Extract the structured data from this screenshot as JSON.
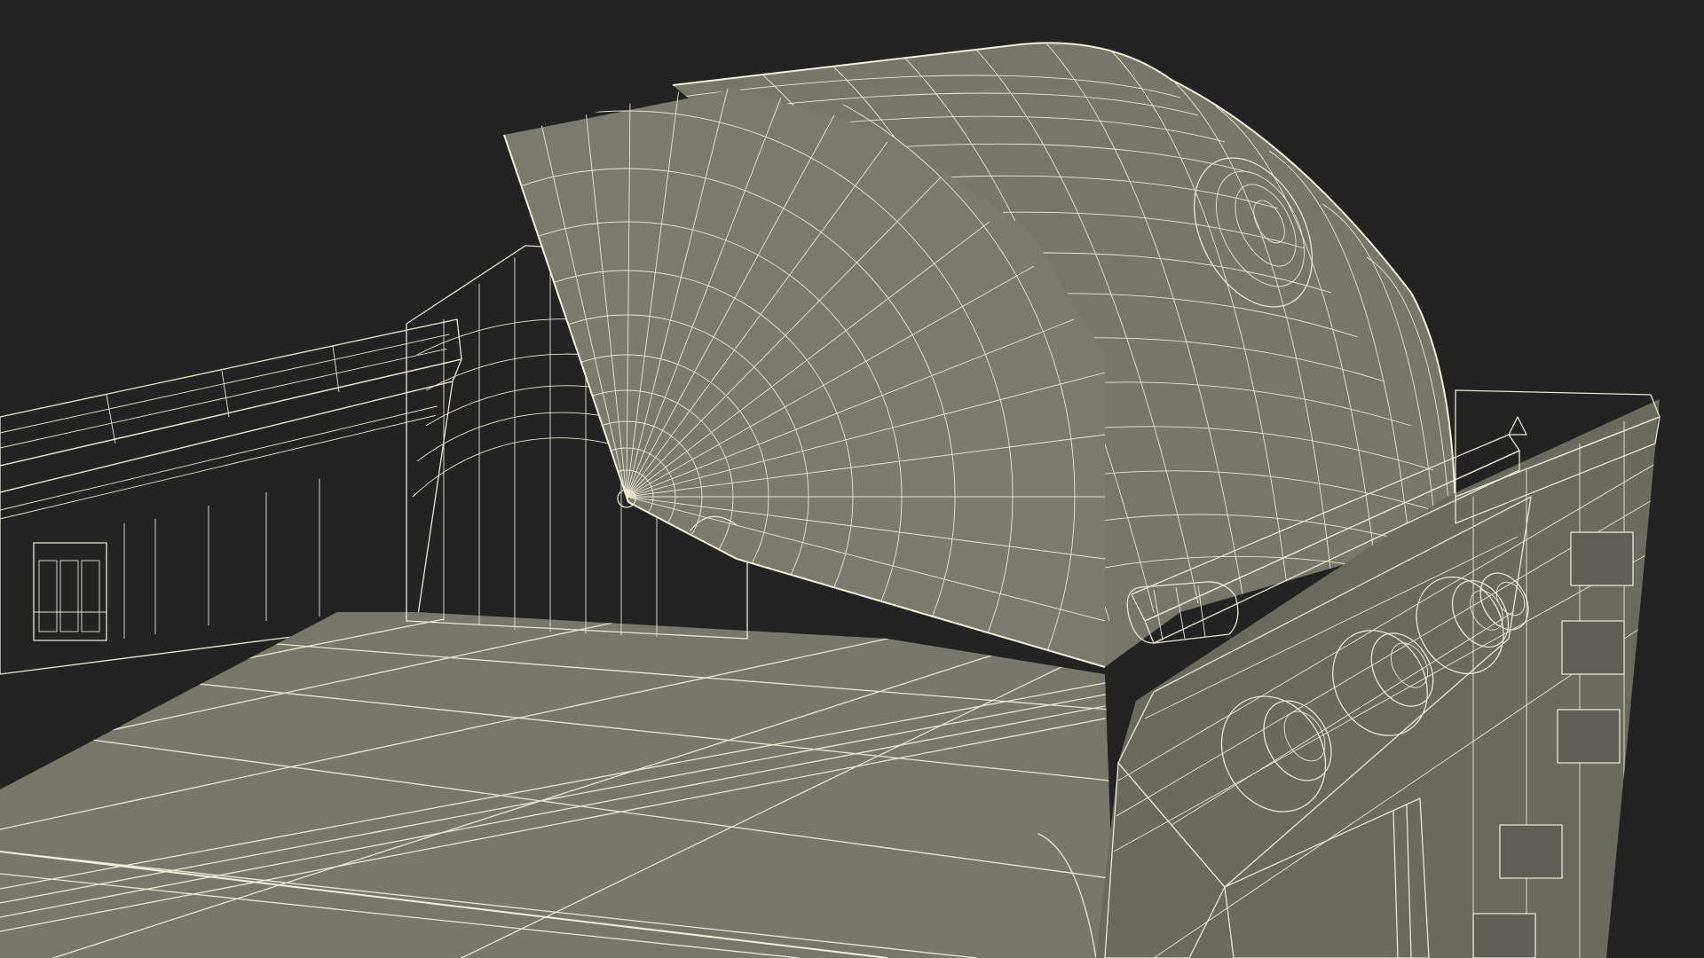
{
  "scene": {
    "background_color": "#232323",
    "surface_color": "#717166",
    "wire_color": "#e9e6d2",
    "knob_count": 4,
    "subject": "grill-wireframe"
  }
}
